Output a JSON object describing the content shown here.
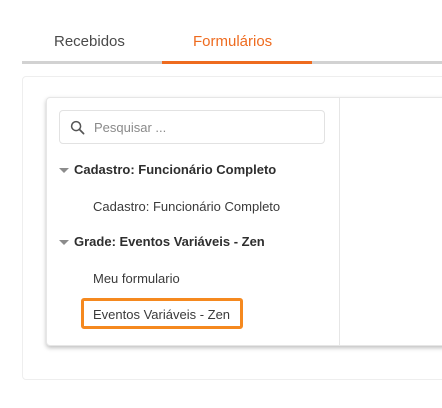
{
  "tabs": [
    {
      "label": "Recebidos",
      "active": false
    },
    {
      "label": "Formulários",
      "active": true
    }
  ],
  "colors": {
    "accent": "#ee6b1f",
    "highlight": "#f5891f",
    "tab_line": "#d2d2d2"
  },
  "search": {
    "placeholder": "Pesquisar ...",
    "icon": "search-icon"
  },
  "tree": {
    "groups": [
      {
        "label": "Cadastro: Funcionário Completo",
        "expanded": true,
        "items": [
          "Cadastro: Funcionário Completo"
        ]
      },
      {
        "label": "Grade: Eventos Variáveis - Zen",
        "expanded": true,
        "items": [
          "Meu formulario",
          "Eventos Variáveis - Zen"
        ]
      }
    ],
    "highlighted_item": "Eventos Variáveis - Zen"
  }
}
